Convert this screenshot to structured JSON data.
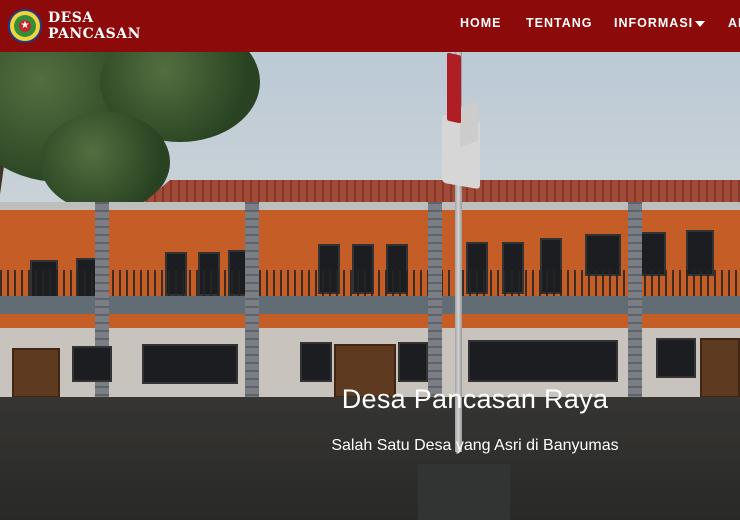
{
  "brand": {
    "line1": "DESA",
    "line2": "PANCASAN",
    "logo_icon": "village-emblem-icon"
  },
  "nav": {
    "home": "HOME",
    "tentang": "TENTANG",
    "informasi": "INFORMASI",
    "cut_item": "AI"
  },
  "hero": {
    "title": "Desa Pancasan Raya",
    "subtitle": "Salah Satu Desa yang Asri di Banyumas"
  },
  "colors": {
    "navbar": "#8c0a0a",
    "text": "#ffffff"
  }
}
